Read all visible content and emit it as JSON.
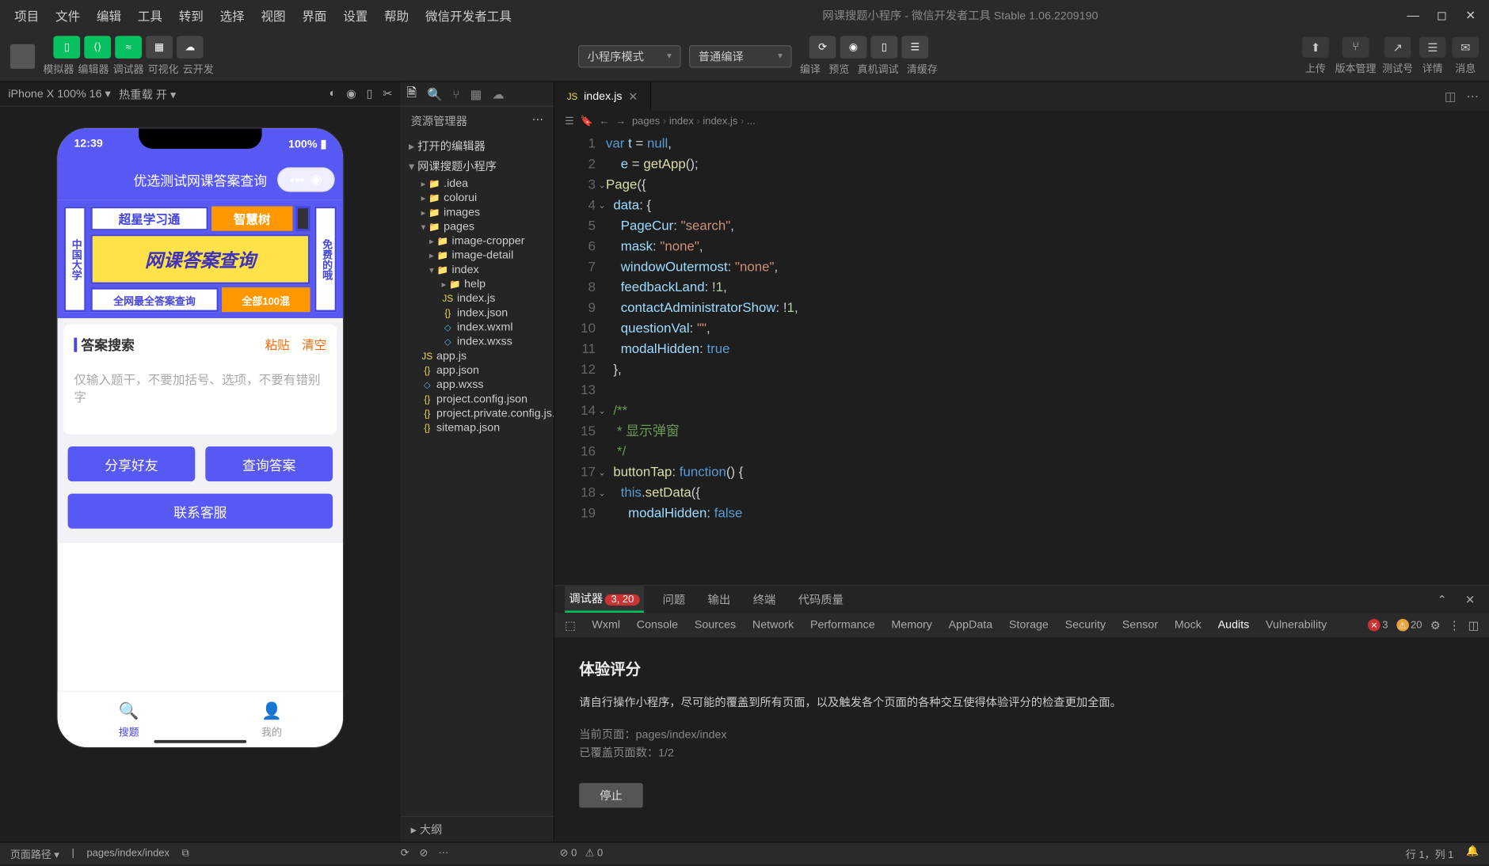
{
  "titlebar": {
    "menus": [
      "项目",
      "文件",
      "编辑",
      "工具",
      "转到",
      "选择",
      "视图",
      "界面",
      "设置",
      "帮助",
      "微信开发者工具"
    ],
    "title": "网课搜题小程序 - 微信开发者工具 Stable 1.06.2209190"
  },
  "toolbar": {
    "groups": [
      "模拟器",
      "编辑器",
      "调试器",
      "可视化",
      "云开发"
    ],
    "mode": "小程序模式",
    "compile": "普通编译",
    "actions": [
      "编译",
      "预览",
      "真机调试",
      "清缓存"
    ],
    "right": [
      "上传",
      "版本管理",
      "测试号",
      "详情",
      "消息"
    ]
  },
  "simulator": {
    "device": "iPhone X 100% 16 ▾",
    "hot": "热重载 开 ▾",
    "phone": {
      "time": "12:39",
      "battery": "100%",
      "app_title": "优选测试网课答案查询",
      "banner_left": "中国大学",
      "banner_r1a": "超星学习通",
      "banner_r1b": "智慧树",
      "banner_main": "网课答案查询",
      "banner_r3a": "全网最全答案查询",
      "banner_r3b": "全部100混",
      "banner_right": "免费的哦",
      "search_title": "答案搜索",
      "paste": "粘贴",
      "clear": "清空",
      "placeholder": "仅输入题干，不要加括号、选项，不要有错别字",
      "btn_share": "分享好友",
      "btn_search": "查询答案",
      "btn_contact": "联系客服",
      "tab1": "搜题",
      "tab2": "我的"
    }
  },
  "explorer": {
    "title": "资源管理器",
    "sections": {
      "open_editors": "打开的编辑器",
      "project": "网课搜题小程序",
      "outline": "大纲"
    },
    "tree": [
      {
        "l": ".idea",
        "d": 0,
        "t": "folder",
        "f": true
      },
      {
        "l": "colorui",
        "d": 0,
        "t": "folder",
        "f": true
      },
      {
        "l": "images",
        "d": 0,
        "t": "folder",
        "f": true
      },
      {
        "l": "pages",
        "d": 0,
        "t": "folder",
        "f": true,
        "o": true
      },
      {
        "l": "image-cropper",
        "d": 1,
        "t": "folder",
        "f": true
      },
      {
        "l": "image-detail",
        "d": 1,
        "t": "folder",
        "f": true
      },
      {
        "l": "index",
        "d": 1,
        "t": "folder",
        "f": true,
        "o": true
      },
      {
        "l": "help",
        "d": 2,
        "t": "folder",
        "f": true
      },
      {
        "l": "index.js",
        "d": 2,
        "t": "js"
      },
      {
        "l": "index.json",
        "d": 2,
        "t": "json"
      },
      {
        "l": "index.wxml",
        "d": 2,
        "t": "wxml"
      },
      {
        "l": "index.wxss",
        "d": 2,
        "t": "wxss"
      },
      {
        "l": "app.js",
        "d": 0,
        "t": "js"
      },
      {
        "l": "app.json",
        "d": 0,
        "t": "json"
      },
      {
        "l": "app.wxss",
        "d": 0,
        "t": "wxss"
      },
      {
        "l": "project.config.json",
        "d": 0,
        "t": "json"
      },
      {
        "l": "project.private.config.js...",
        "d": 0,
        "t": "json"
      },
      {
        "l": "sitemap.json",
        "d": 0,
        "t": "json"
      }
    ]
  },
  "editor": {
    "tab": "index.js",
    "breadcrumb": [
      "pages",
      "index",
      "index.js",
      "..."
    ],
    "code": [
      {
        "n": 1,
        "h": "<span class='kw'>var</span> <span class='va'>t</span> = <span class='kw'>null</span>,"
      },
      {
        "n": 2,
        "h": "    <span class='va'>e</span> = <span class='fn'>getApp</span>();"
      },
      {
        "n": 3,
        "h": "<span class='fn'>Page</span>({",
        "f": true
      },
      {
        "n": 4,
        "h": "  <span class='at'>data</span>: {",
        "f": true
      },
      {
        "n": 5,
        "h": "    <span class='at'>PageCur</span>: <span class='st'>\"search\"</span>,"
      },
      {
        "n": 6,
        "h": "    <span class='at'>mask</span>: <span class='st'>\"none\"</span>,"
      },
      {
        "n": 7,
        "h": "    <span class='at'>windowOutermost</span>: <span class='st'>\"none\"</span>,"
      },
      {
        "n": 8,
        "h": "    <span class='at'>feedbackLand</span>: !<span class='nm'>1</span>,"
      },
      {
        "n": 9,
        "h": "    <span class='at'>contactAdministratorShow</span>: !<span class='nm'>1</span>,"
      },
      {
        "n": 10,
        "h": "    <span class='at'>questionVal</span>: <span class='st'>\"\"</span>,"
      },
      {
        "n": 11,
        "h": "    <span class='at'>modalHidden</span>: <span class='kw'>true</span>"
      },
      {
        "n": 12,
        "h": "  },"
      },
      {
        "n": 13,
        "h": ""
      },
      {
        "n": 14,
        "h": "  <span class='cm'>/**</span>",
        "f": true
      },
      {
        "n": 15,
        "h": "<span class='cm'>   * 显示弹窗</span>"
      },
      {
        "n": 16,
        "h": "<span class='cm'>   */</span>"
      },
      {
        "n": 17,
        "h": "  <span class='fn'>buttonTap</span>: <span class='kw'>function</span>() {",
        "f": true
      },
      {
        "n": 18,
        "h": "    <span class='kw'>this</span>.<span class='fn'>setData</span>({",
        "f": true
      },
      {
        "n": 19,
        "h": "      <span class='at'>modalHidden</span>: <span class='kw'>false</span>"
      }
    ]
  },
  "debugger": {
    "top_tabs": [
      "调试器",
      "问题",
      "输出",
      "终端",
      "代码质量"
    ],
    "badge": "3, 20",
    "sub_tabs": [
      "Wxml",
      "Console",
      "Sources",
      "Network",
      "Performance",
      "Memory",
      "AppData",
      "Storage",
      "Security",
      "Sensor",
      "Mock",
      "Audits",
      "Vulnerability"
    ],
    "active_sub": "Audits",
    "errors": "3",
    "warnings": "20",
    "audit": {
      "title": "体验评分",
      "desc": "请自行操作小程序，尽可能的覆盖到所有页面，以及触发各个页面的各种交互使得体验评分的检查更加全面。",
      "current_label": "当前页面：",
      "current": "pages/index/index",
      "covered_label": "已覆盖页面数：",
      "covered": "1/2",
      "stop": "停止"
    }
  },
  "statusbar": {
    "path_label": "页面路径 ▾",
    "path": "pages/index/index",
    "errs": "0",
    "warns": "0",
    "pos": "行 1，列 1"
  }
}
